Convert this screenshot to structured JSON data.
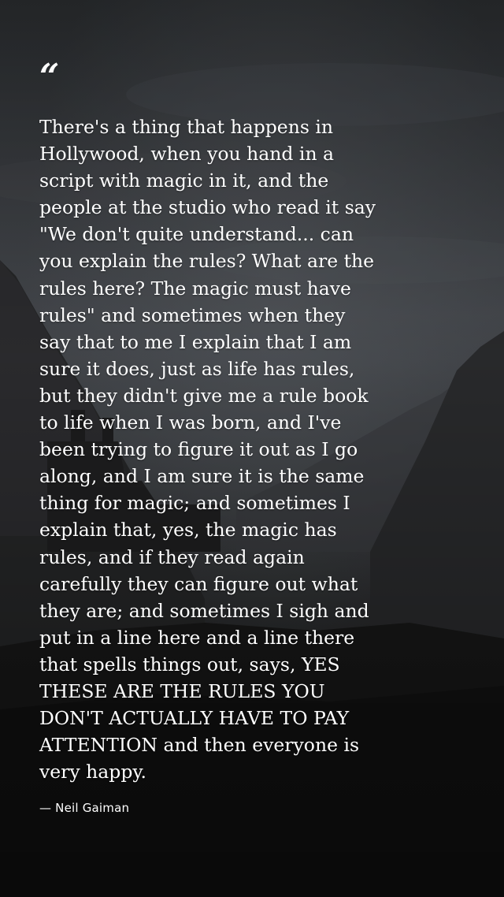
{
  "quote": {
    "mark": "“",
    "text": "There's a thing that happens in\nHollywood, when you hand in a\nscript with magic in it, and the\npeople at the studio who read it say\n\"We don't quite understand... can\nyou explain the rules? What are the\nrules here? The magic must have\nrules\" and sometimes when they\nsay that to me I explain that I am\nsure it does, just as life has rules,\nbut they didn't give me a rule book\nto life when I was born, and I've\nbeen trying to figure it out as I go\nalong, and I am sure it is the same\nthing for magic; and sometimes I\nexplain that, yes, the magic has\nrules, and if they read again\ncarefully they can figure out what\nthey are; and sometimes I sigh and\nput in a line here and a line there\nthat spells things out, says, YES\nTHESE ARE THE RULES YOU\nDON'T ACTUALLY HAVE TO PAY\nATTENTION and then everyone is\nvery happy.",
    "author": "— Neil Gaiman"
  },
  "colors": {
    "text": "#ffffff",
    "sky_top": "#3a3d42",
    "sky_mid": "#4a4d52",
    "ground": "#141414"
  }
}
